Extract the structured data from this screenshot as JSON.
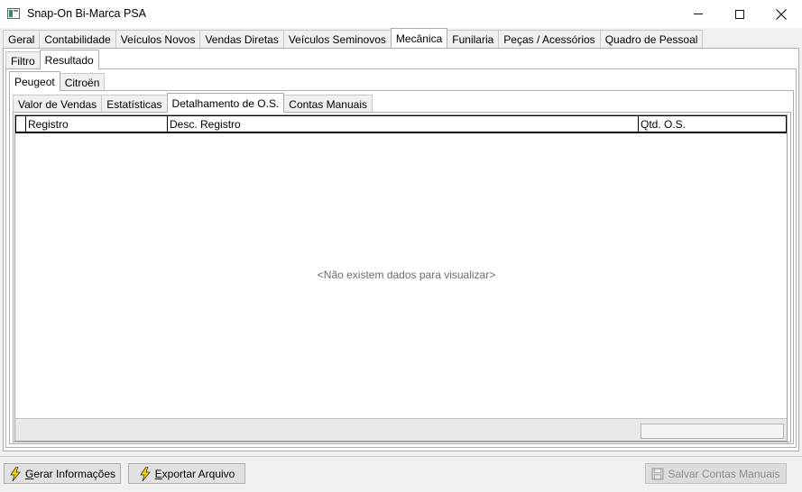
{
  "window": {
    "title": "Snap-On Bi-Marca PSA",
    "minimize_icon": "minimize-icon",
    "maximize_icon": "maximize-icon",
    "close_icon": "close-icon"
  },
  "main_tabs": [
    {
      "label": "Geral"
    },
    {
      "label": "Contabilidade"
    },
    {
      "label": "Veículos Novos"
    },
    {
      "label": "Vendas Diretas"
    },
    {
      "label": "Veículos Seminovos"
    },
    {
      "label": "Mecânica",
      "active": true
    },
    {
      "label": "Funilaria"
    },
    {
      "label": "Peças / Acessórios"
    },
    {
      "label": "Quadro de Pessoal"
    }
  ],
  "sub_tabs": [
    {
      "label": "Filtro"
    },
    {
      "label": "Resultado",
      "active": true
    }
  ],
  "brand_tabs": [
    {
      "label": "Peugeot",
      "active": true
    },
    {
      "label": "Citroën"
    }
  ],
  "report_tabs": [
    {
      "label": "Valor de Vendas"
    },
    {
      "label": "Estatísticas"
    },
    {
      "label": "Detalhamento de O.S.",
      "active": true
    },
    {
      "label": "Contas Manuais"
    }
  ],
  "grid": {
    "columns": [
      "Registro",
      "Desc. Registro",
      "Qtd. O.S."
    ],
    "empty_message": "<Não existem dados para visualizar>"
  },
  "buttons": {
    "generate": {
      "first": "G",
      "rest": "erar Informações",
      "icon": "lightning-icon"
    },
    "export": {
      "first": "E",
      "rest": "xportar Arquivo",
      "icon": "lightning-icon"
    },
    "save_manual": {
      "label": "Salvar Contas Manuais",
      "icon": "save-icon",
      "disabled": true
    }
  }
}
